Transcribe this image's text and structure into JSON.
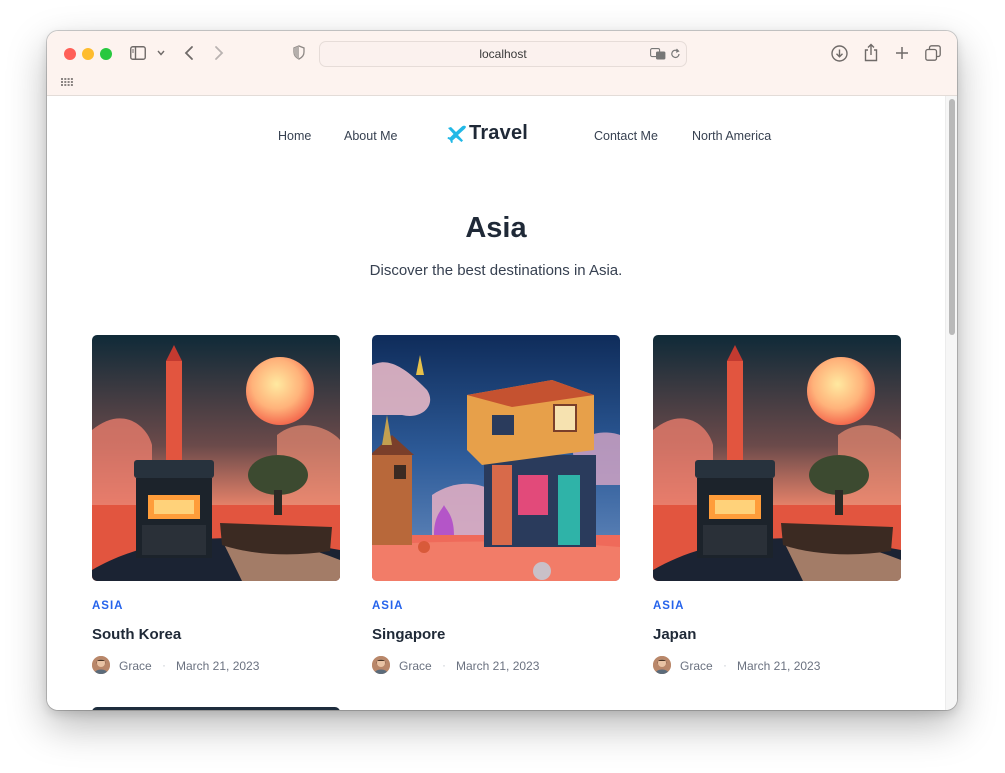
{
  "browser": {
    "url": "localhost",
    "colors": {
      "close": "#ff5f57",
      "minimize": "#febc2e",
      "zoom": "#28c840"
    }
  },
  "site": {
    "logo_text": "Travel",
    "nav": {
      "home": "Home",
      "about": "About Me",
      "contact": "Contact Me",
      "north_america": "North America"
    },
    "hero": {
      "title": "Asia",
      "subtitle": "Discover the best destinations in Asia."
    },
    "cards": [
      {
        "tag": "ASIA",
        "title": "South Korea",
        "author": "Grace",
        "separator": "·",
        "date": "March 21, 2023",
        "image": "sunset-tower-illustration"
      },
      {
        "tag": "ASIA",
        "title": "Singapore",
        "author": "Grace",
        "separator": "·",
        "date": "March 21, 2023",
        "image": "colorful-houses-illustration"
      },
      {
        "tag": "ASIA",
        "title": "Japan",
        "author": "Grace",
        "separator": "·",
        "date": "March 21, 2023",
        "image": "sunset-tower-illustration"
      }
    ],
    "accent_color": "#2563eb",
    "logo_color": "#22b8e6"
  }
}
